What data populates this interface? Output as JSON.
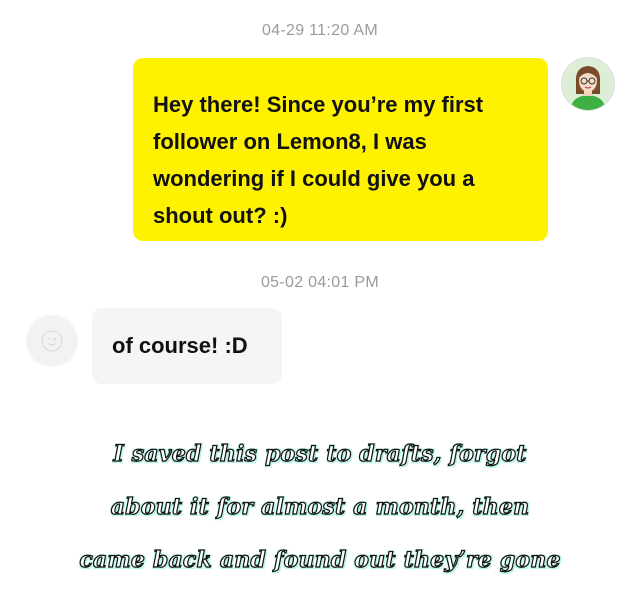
{
  "conversation": {
    "timestamps": [
      "04-29 11:20 AM",
      "05-02 04:01 PM"
    ],
    "messages": [
      {
        "side": "outgoing",
        "text": "Hey there! Since you’re my first follower on Lemon8, I was wondering if I could give you a shout out? :)"
      },
      {
        "side": "incoming",
        "text": "of course! :D"
      }
    ],
    "bubble_colors": {
      "outgoing": "#fff200",
      "incoming": "#f5f5f5"
    }
  },
  "avatars": {
    "self": "user-avatar-icon",
    "other": "default-avatar-icon"
  },
  "caption": {
    "lines": [
      "I saved this post to drafts, forgot",
      "about it for almost a month, then",
      "came back and found out they’re gone"
    ]
  }
}
